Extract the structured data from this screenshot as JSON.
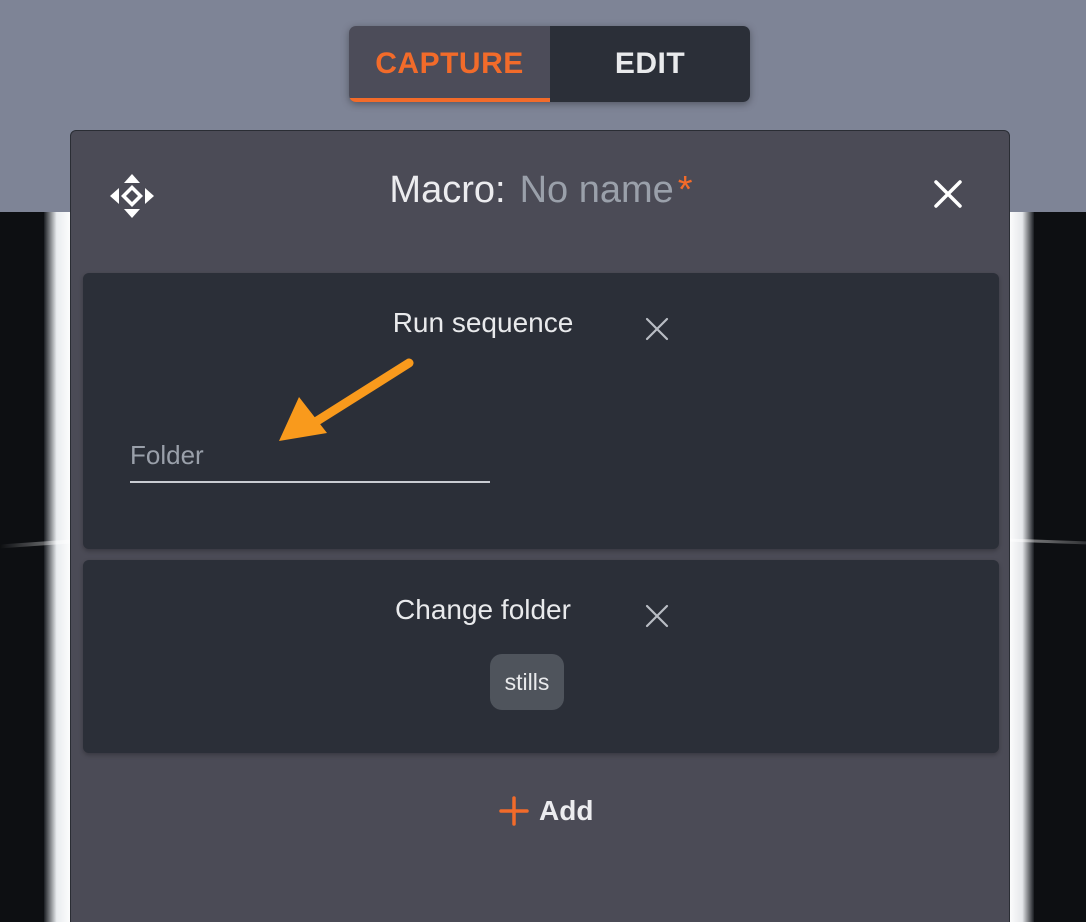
{
  "mode_toggle": {
    "capture_label": "CAPTURE",
    "edit_label": "EDIT",
    "active": "CAPTURE"
  },
  "macro": {
    "title_label": "Macro:",
    "name": "No name",
    "unsaved_marker": "*"
  },
  "actions": [
    {
      "title": "Run sequence",
      "field": {
        "placeholder": "Folder",
        "value": ""
      }
    },
    {
      "title": "Change folder",
      "chip_value": "stills"
    }
  ],
  "add_label": "Add",
  "colors": {
    "accent": "#f26b2a",
    "arrow_annotation": "#f99a1c",
    "panel_bg": "#4b4b56",
    "card_bg": "#2b2f38"
  },
  "icons": [
    "move-icon",
    "close-icon",
    "remove-icon",
    "plus-icon",
    "arrow-annotation"
  ]
}
